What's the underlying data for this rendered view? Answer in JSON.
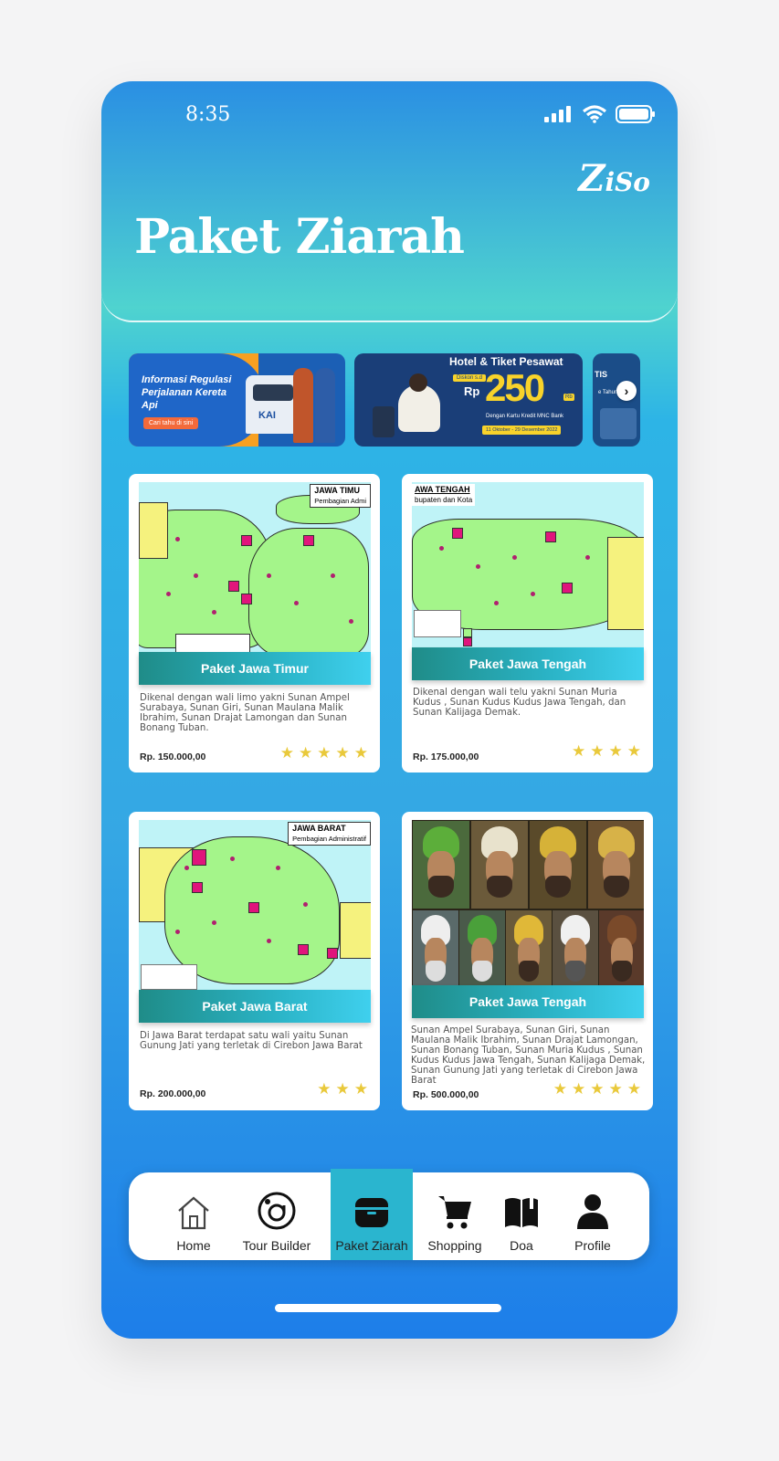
{
  "status_bar": {
    "time": "8:35"
  },
  "brand": {
    "logo_initial": "Z",
    "logo_rest": "iSo"
  },
  "header": {
    "title": "Paket Ziarah"
  },
  "banners": {
    "b1": {
      "text": "Informasi Regulasi Perjalanan Kereta Api",
      "cta": "Cari tahu di sini",
      "brand": "KAI"
    },
    "b2": {
      "title": "Hotel & Tiket Pesawat",
      "tag": "Diskon s.d",
      "currency": "Rp",
      "amount": "250",
      "unit": "Rb",
      "subtitle": "Dengan Kartu Kredit MNC Bank",
      "date": "11 Oktober - 29 Desember 2022"
    },
    "b3": {
      "text": "TIS",
      "sub": "e Tahun"
    },
    "next_icon": "chevron-right-icon"
  },
  "cards": [
    {
      "map_title": "JAWA TIMU",
      "map_subtitle": "Pembagian Admi",
      "label": "Paket Jawa Timur",
      "desc": "Dikenal dengan wali limo yakni Sunan Ampel Surabaya, Sunan Giri, Sunan Maulana Malik Ibrahim, Sunan Drajat Lamongan dan Sunan Bonang Tuban.",
      "price": "Rp. 150.000,00",
      "rating": 5,
      "stars": "★★★★★"
    },
    {
      "map_title": "AWA TENGAH",
      "map_subtitle": "bupaten dan Kota",
      "label": "Paket Jawa Tengah",
      "desc": "Dikenal dengan wali telu yakni Sunan Muria Kudus , Sunan Kudus Kudus Jawa Tengah, dan Sunan Kalijaga Demak.",
      "price": "Rp. 175.000,00",
      "rating": 4,
      "stars": "★★★★"
    },
    {
      "map_title": "JAWA BARAT",
      "map_subtitle": "Pembagian Administratif",
      "label": "Paket Jawa Barat",
      "desc": "Di Jawa Barat terdapat satu wali yaitu Sunan Gunung Jati yang terletak di Cirebon Jawa Barat",
      "price": "Rp. 200.000,00",
      "rating": 3,
      "stars": "★★★"
    },
    {
      "label": "Paket Jawa Tengah",
      "desc": "Sunan Ampel Surabaya, Sunan Giri, Sunan Maulana Malik Ibrahim, Sunan Drajat Lamongan, Sunan Bonang Tuban,  Sunan Muria Kudus , Sunan Kudus Kudus Jawa Tengah, Sunan Kalijaga Demak, Sunan Gunung Jati yang terletak di Cirebon Jawa Barat",
      "price": "Rp. 500.000,00",
      "rating": 5,
      "stars": "★★★★★"
    }
  ],
  "nav": [
    {
      "label": "Home",
      "icon": "house-icon",
      "active": false
    },
    {
      "label": "Tour Builder",
      "icon": "at-circle-icon",
      "active": false
    },
    {
      "label": "Paket Ziarah",
      "icon": "box-icon",
      "active": true
    },
    {
      "label": "Shopping",
      "icon": "cart-icon",
      "active": false
    },
    {
      "label": "Doa",
      "icon": "book-icon",
      "active": false
    },
    {
      "label": "Profile",
      "icon": "person-icon",
      "active": false
    }
  ],
  "colors": {
    "accent": "#2ab5cf",
    "star": "#e9c93b",
    "band_start": "#1f8c88",
    "band_end": "#3fd0ee"
  }
}
